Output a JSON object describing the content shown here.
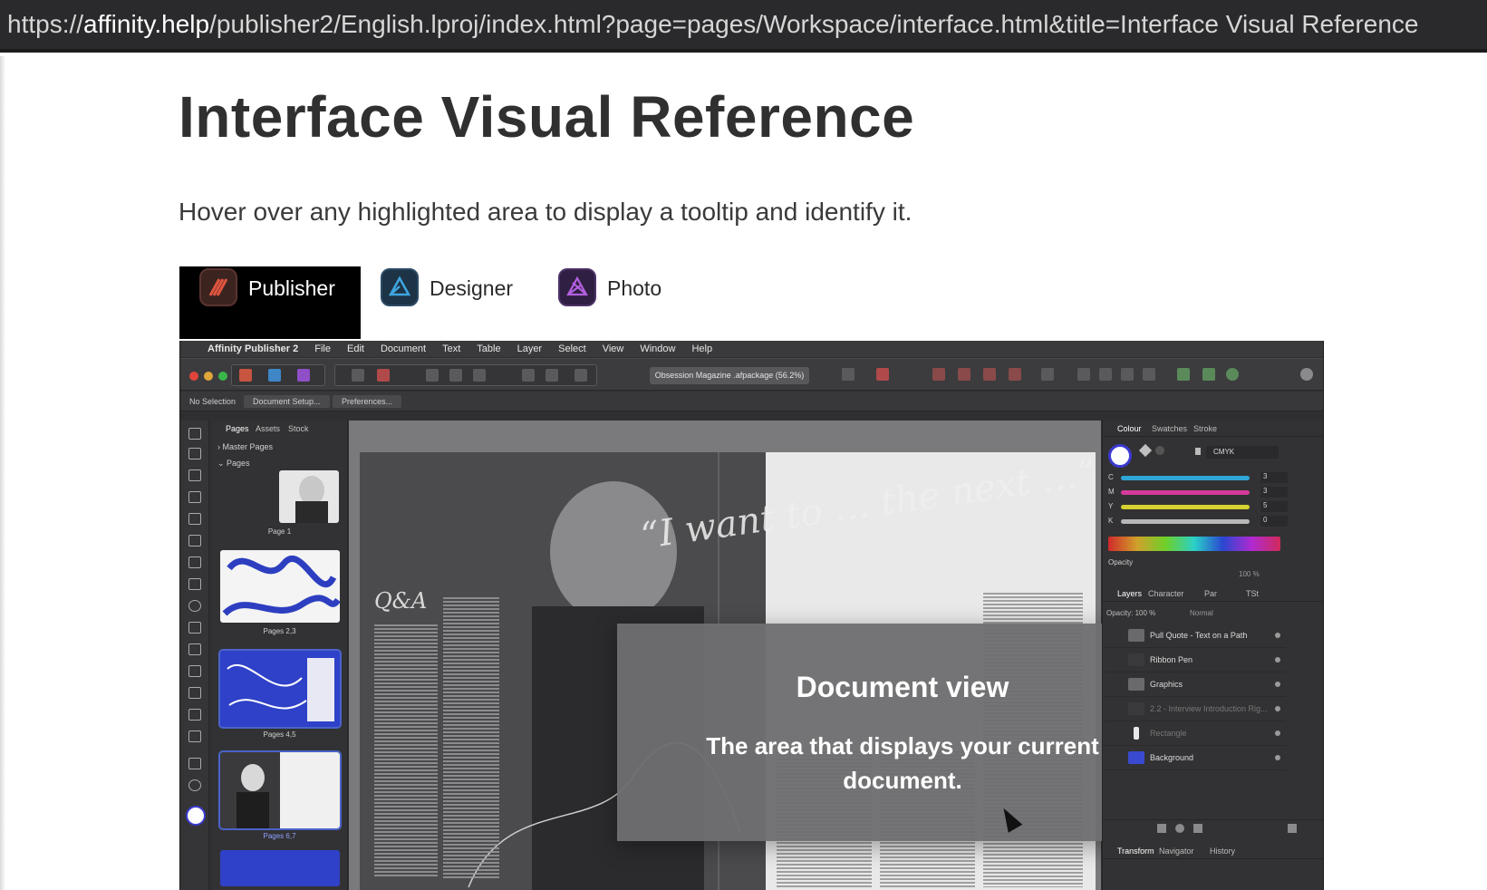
{
  "browser": {
    "url_prefix": "https://",
    "url_domain": "affinity.help",
    "url_rest": "/publisher2/English.lproj/index.html?page=pages/Workspace/interface.html&title=Interface Visual Reference"
  },
  "page": {
    "title": "Interface Visual Reference",
    "subtitle": "Hover over any highlighted area to display a tooltip and identify it."
  },
  "app_tabs": [
    {
      "label": "Publisher",
      "icon": "affinity-publisher-logo-icon",
      "active": true
    },
    {
      "label": "Designer",
      "icon": "affinity-designer-logo-icon",
      "active": false
    },
    {
      "label": "Photo",
      "icon": "affinity-photo-logo-icon",
      "active": false
    }
  ],
  "app": {
    "menu": {
      "apple": "",
      "app_name": "Affinity Publisher 2",
      "items": [
        "File",
        "Edit",
        "Document",
        "Text",
        "Table",
        "Layer",
        "Select",
        "View",
        "Window",
        "Help"
      ]
    },
    "toolbar": {
      "document_name": "Obsession Magazine .afpackage (56.2%)"
    },
    "context_toolbar": {
      "selection": "No Selection",
      "document_setup": "Document Setup...",
      "preferences": "Preferences..."
    },
    "pages_panel": {
      "tabs": [
        "Pages",
        "Assets",
        "Stock"
      ],
      "master_pages": "Master Pages",
      "pages": "Pages",
      "thumbs": [
        "Page 1",
        "Pages 2,3",
        "Pages 4,5",
        "Pages 6,7"
      ]
    },
    "document": {
      "quote": "“I want to … the next …”",
      "qa": "Q&A"
    },
    "tooltip": {
      "title": "Document view",
      "body": "The area that displays your current document."
    },
    "colour_panel": {
      "tabs": [
        "Colour",
        "Swatches",
        "Stroke"
      ],
      "mode": "CMYK",
      "channels": [
        {
          "key": "C",
          "value": "3",
          "color": "#2fa7d6"
        },
        {
          "key": "M",
          "value": "3",
          "color": "#d63a9a"
        },
        {
          "key": "Y",
          "value": "5",
          "color": "#d6d22f"
        },
        {
          "key": "K",
          "value": "0",
          "color": "#b8b8b8"
        }
      ],
      "opacity_label": "Opacity",
      "opacity_value": "100 %"
    },
    "layers_panel": {
      "tabs": [
        "Layers",
        "Character",
        "Par",
        "TSt"
      ],
      "opacity": "Opacity: 100 %",
      "blend": "Normal",
      "layers": [
        {
          "name": "Pull Quote - Text on a Path",
          "swatch": "#6a6a6c",
          "dim": false
        },
        {
          "name": "Ribbon Pen",
          "swatch": "#3a3a3c",
          "dim": false
        },
        {
          "name": "Graphics",
          "swatch": "#6a6a6c",
          "dim": false
        },
        {
          "name": "2.2 - Interview Introduction Rig...",
          "swatch": "#3a3a3c",
          "dim": true
        },
        {
          "name": "Rectangle",
          "swatch": "#e8e8e8",
          "dim": true
        },
        {
          "name": "Background",
          "swatch": "#3a4ad0",
          "dim": false
        }
      ]
    },
    "bottom_panel": {
      "tabs": [
        "Transform",
        "Navigator",
        "History"
      ]
    }
  }
}
